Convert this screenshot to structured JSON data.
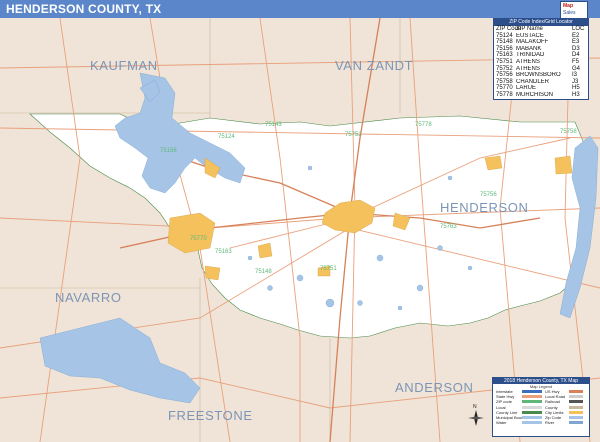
{
  "header": {
    "title": "HENDERSON COUNTY, TX"
  },
  "counties": [
    {
      "name": "KAUFMAN"
    },
    {
      "name": "VAN ZANDT"
    },
    {
      "name": "HENDERSON"
    },
    {
      "name": "NAVARRO"
    },
    {
      "name": "FREESTONE"
    },
    {
      "name": "ANDERSON"
    }
  ],
  "map_labels": [
    "75124",
    "75752",
    "75756",
    "75143",
    "75148",
    "75763",
    "75751",
    "75758",
    "75778",
    "75770",
    "75156",
    "75163"
  ],
  "zip_table": {
    "title": "ZIP Code Index/Grid Locator",
    "columns": [
      "ZIP Code",
      "ZIP Name",
      "LOC"
    ],
    "rows": [
      [
        "75124",
        "EUSTACE",
        "E2"
      ],
      [
        "75148",
        "MALAKOFF",
        "E3"
      ],
      [
        "75156",
        "MABANK",
        "D3"
      ],
      [
        "75163",
        "TRINIDAD",
        "D4"
      ],
      [
        "75751",
        "ATHENS",
        "F5"
      ],
      [
        "75752",
        "ATHENS",
        "G4"
      ],
      [
        "75756",
        "BROWNSBORO",
        "I3"
      ],
      [
        "75758",
        "CHANDLER",
        "J3"
      ],
      [
        "75770",
        "LARUE",
        "H5"
      ],
      [
        "75778",
        "MURCHISON",
        "H3"
      ]
    ]
  },
  "legend": {
    "title": "2018 Henderson County, TX Map",
    "subtitle": "Map Legend",
    "left_items": [
      "Interstate",
      "State Hwy",
      "ZIP code",
      "Local",
      "County Line",
      "Municipal Boundary",
      "Water",
      "Parks",
      "Airport",
      "Hospital"
    ],
    "right_items": [
      "US Hwy",
      "Local Road",
      "Railroad",
      "County",
      "City Limits",
      "Zip Code",
      "River",
      "Lake",
      "School",
      "Scale"
    ]
  },
  "colors": {
    "title_bar": "#5b86c9",
    "water": "#a5c4e6",
    "land_outside": "#efe4d7",
    "county_fill": "#ffffff",
    "city": "#f4c15c",
    "roads": "#e9a07c",
    "county_label": "#7c95b6"
  }
}
